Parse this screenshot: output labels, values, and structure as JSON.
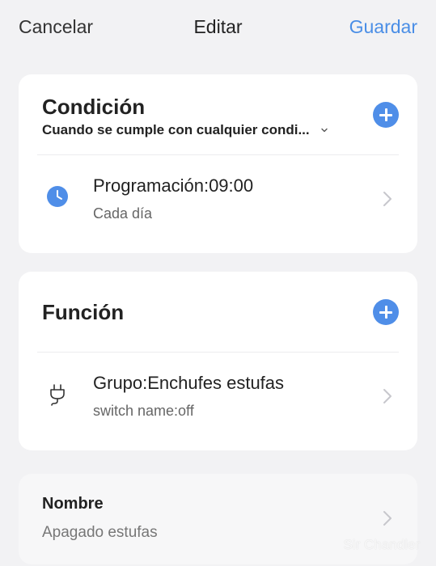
{
  "nav": {
    "cancel_label": "Cancelar",
    "title": "Editar",
    "save_label": "Guardar"
  },
  "condition": {
    "title": "Condición",
    "subtitle": "Cuando se cumple con cualquier condi...",
    "row": {
      "title": "Programación:09:00",
      "subtitle": "Cada día",
      "icon": "clock-icon"
    }
  },
  "function": {
    "title": "Función",
    "row": {
      "title": "Grupo:Enchufes estufas",
      "subtitle": "switch name:off",
      "icon": "plug-icon"
    }
  },
  "name": {
    "label": "Nombre",
    "value": "Apagado estufas"
  },
  "watermark": "Sir Chandler",
  "colors": {
    "accent": "#4a8ee6",
    "background": "#f2f2f4",
    "card": "#ffffff"
  }
}
